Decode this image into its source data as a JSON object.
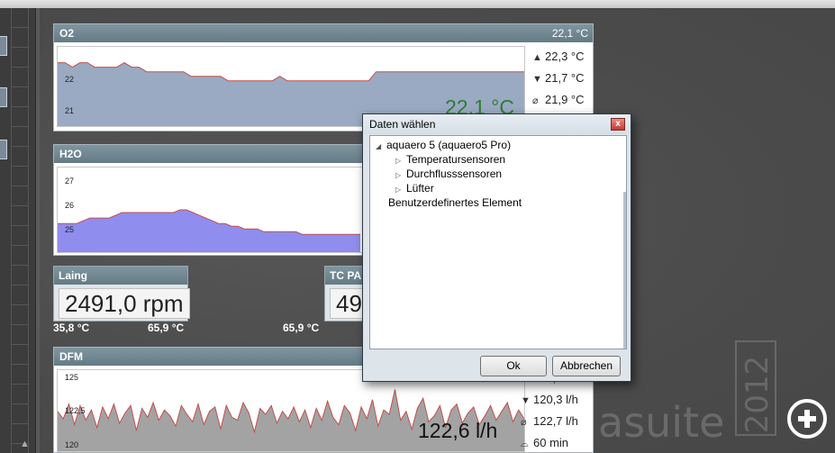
{
  "o2": {
    "title": "O2",
    "header_value": "22,1 °C",
    "current_value": "22,1 °C",
    "y_ticks": [
      "22",
      "21"
    ],
    "stats": {
      "max": "22,3 °C",
      "min": "21,7 °C",
      "avg": "21,9 °C"
    },
    "series": [
      22.1,
      22.1,
      22.0,
      22.1,
      22.1,
      22.0,
      22.0,
      22.0,
      22.0,
      22.1,
      22.0,
      22.0,
      21.9,
      21.9,
      21.9,
      21.9,
      21.9,
      21.9,
      21.8,
      21.8,
      21.8,
      21.8,
      21.8,
      21.7,
      21.7,
      21.7,
      21.7,
      21.7,
      21.7,
      21.7,
      21.8,
      21.7,
      21.7,
      21.7,
      21.7,
      21.7,
      21.7,
      21.7,
      21.7,
      21.7,
      21.7,
      21.7,
      21.7,
      21.9,
      21.9,
      21.9,
      21.9,
      21.9,
      21.9,
      21.9,
      21.9,
      21.9,
      21.9,
      21.9,
      21.9,
      21.9,
      21.9,
      21.9,
      21.9,
      21.9,
      21.9,
      21.9,
      21.9,
      21.9
    ]
  },
  "h2o": {
    "title": "H2O",
    "y_ticks": [
      "27",
      "26",
      "25"
    ],
    "series": [
      25.5,
      25.5,
      25.5,
      25.5,
      25.6,
      25.7,
      25.7,
      25.7,
      25.7,
      25.8,
      25.9,
      25.9,
      25.9,
      25.9,
      25.9,
      25.9,
      25.9,
      25.9,
      25.9,
      26.0,
      26.0,
      25.9,
      25.8,
      25.7,
      25.6,
      25.5,
      25.5,
      25.4,
      25.4,
      25.3,
      25.3,
      25.3,
      25.2,
      25.2,
      25.2,
      25.2,
      25.2,
      25.2,
      25.1,
      25.1,
      25.1,
      25.1,
      25.1,
      25.1,
      25.1,
      25.1,
      25.1,
      25.1
    ]
  },
  "laing": {
    "title": "Laing",
    "value": "2491,0 rpm",
    "temp_left": "35,8 °C",
    "temp_right": "65,9 °C"
  },
  "tc": {
    "title": "TC PA1",
    "value": "49",
    "temp": "65,9 °C"
  },
  "dfm": {
    "title": "DFM",
    "current_value": "122,6 l/h",
    "y_ticks": [
      "125",
      "122,5",
      "120"
    ],
    "stats": {
      "max": "123,1 l/h",
      "min": "120,3 l/h",
      "avg": "122,7 l/h",
      "range": "60 min"
    },
    "series": [
      122.5,
      122.0,
      123.0,
      121.6,
      122.9,
      121.9,
      122.6,
      121.4,
      122.8,
      122.0,
      123.0,
      121.7,
      122.4,
      122.9,
      121.2,
      122.7,
      122.1,
      123.1,
      121.9,
      122.6,
      122.2,
      121.5,
      122.9,
      122.3,
      121.8,
      123.0,
      121.6,
      122.5,
      122.8,
      121.3,
      122.9,
      122.1,
      121.9,
      123.1,
      122.4,
      121.1,
      122.7,
      122.3,
      122.9,
      121.7,
      122.5,
      122.0,
      122.8,
      121.8,
      122.6,
      121.4,
      122.7,
      121.9,
      123.2,
      122.1,
      121.6,
      122.9,
      122.4,
      121.2,
      122.8,
      122.0,
      123.3,
      121.5,
      122.6,
      122.3,
      124.0,
      121.9,
      122.5,
      121.3,
      122.7,
      123.4,
      121.8,
      122.2,
      122.9,
      121.4,
      122.6,
      123.0,
      121.7,
      122.4,
      122.8,
      121.6,
      122.2,
      122.9,
      121.9,
      122.5,
      123.1,
      121.8,
      122.6,
      122.0
    ]
  },
  "branding": {
    "watermark": "asuite",
    "year": "2012"
  },
  "dialog": {
    "title": "Daten wählen",
    "close_label": "x",
    "tree": {
      "root": "aquaero 5 (aquaero5 Pro)",
      "children": [
        "Temperatursensoren",
        "Durchflusssensoren",
        "Lüfter"
      ],
      "custom": "Benutzerdefinertes Element"
    },
    "ok_label": "Ok",
    "cancel_label": "Abbrechen"
  },
  "colors": {
    "panel_header": "#6f8691",
    "o2_fill": "#9aaac3",
    "h2o_fill": "#8f8dee",
    "dfm_fill": "#a3a3a3",
    "line": "#c0504d",
    "current_green": "#2e7d32"
  },
  "icons": {
    "max": "max-arrow-icon",
    "min": "min-arrow-icon",
    "avg": "average-icon",
    "range": "time-range-icon",
    "add": "plus-circle-icon"
  }
}
